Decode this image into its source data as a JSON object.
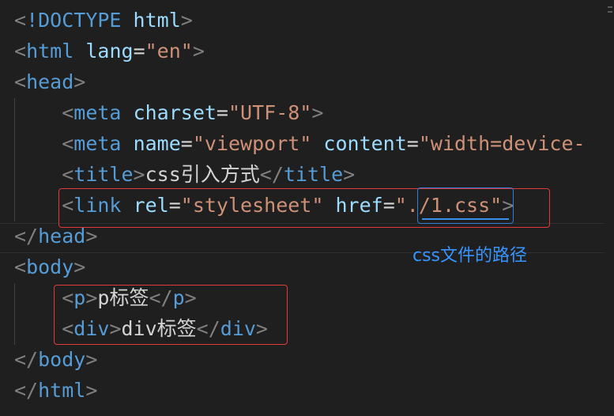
{
  "editor": {
    "lines": [
      [
        {
          "t": "bracket",
          "v": "<"
        },
        {
          "t": "tag",
          "v": "!DOCTYPE"
        },
        {
          "t": "text",
          "v": " "
        },
        {
          "t": "attr",
          "v": "html"
        },
        {
          "t": "bracket",
          "v": ">"
        }
      ],
      [
        {
          "t": "bracket",
          "v": "<"
        },
        {
          "t": "tag",
          "v": "html"
        },
        {
          "t": "text",
          "v": " "
        },
        {
          "t": "attr",
          "v": "lang"
        },
        {
          "t": "text",
          "v": "="
        },
        {
          "t": "str",
          "v": "\"en\""
        },
        {
          "t": "bracket",
          "v": ">"
        }
      ],
      [
        {
          "t": "bracket",
          "v": "<"
        },
        {
          "t": "tag",
          "v": "head"
        },
        {
          "t": "bracket",
          "v": ">"
        }
      ],
      [
        {
          "t": "text",
          "v": "    "
        },
        {
          "t": "bracket",
          "v": "<"
        },
        {
          "t": "tag",
          "v": "meta"
        },
        {
          "t": "text",
          "v": " "
        },
        {
          "t": "attr",
          "v": "charset"
        },
        {
          "t": "text",
          "v": "="
        },
        {
          "t": "str",
          "v": "\"UTF-8\""
        },
        {
          "t": "bracket",
          "v": ">"
        }
      ],
      [
        {
          "t": "text",
          "v": "    "
        },
        {
          "t": "bracket",
          "v": "<"
        },
        {
          "t": "tag",
          "v": "meta"
        },
        {
          "t": "text",
          "v": " "
        },
        {
          "t": "attr",
          "v": "name"
        },
        {
          "t": "text",
          "v": "="
        },
        {
          "t": "str",
          "v": "\"viewport\""
        },
        {
          "t": "text",
          "v": " "
        },
        {
          "t": "attr",
          "v": "content"
        },
        {
          "t": "text",
          "v": "="
        },
        {
          "t": "str",
          "v": "\"width=device-"
        }
      ],
      [
        {
          "t": "text",
          "v": "    "
        },
        {
          "t": "bracket",
          "v": "<"
        },
        {
          "t": "tag",
          "v": "title"
        },
        {
          "t": "bracket",
          "v": ">"
        },
        {
          "t": "text",
          "v": "css引入方式"
        },
        {
          "t": "bracket",
          "v": "</"
        },
        {
          "t": "tag",
          "v": "title"
        },
        {
          "t": "bracket",
          "v": ">"
        }
      ],
      [
        {
          "t": "text",
          "v": "    "
        },
        {
          "t": "bracket",
          "v": "<"
        },
        {
          "t": "tag",
          "v": "link"
        },
        {
          "t": "text",
          "v": " "
        },
        {
          "t": "attr",
          "v": "rel"
        },
        {
          "t": "text",
          "v": "="
        },
        {
          "t": "str",
          "v": "\"stylesheet\""
        },
        {
          "t": "text",
          "v": " "
        },
        {
          "t": "attr",
          "v": "href"
        },
        {
          "t": "text",
          "v": "="
        },
        {
          "t": "str",
          "v": "\"./1.css\""
        },
        {
          "t": "bracket",
          "v": ">"
        }
      ],
      [
        {
          "t": "bracket",
          "v": "</"
        },
        {
          "t": "tag",
          "v": "head"
        },
        {
          "t": "bracket",
          "v": ">"
        }
      ],
      [
        {
          "t": "bracket",
          "v": "<"
        },
        {
          "t": "tag",
          "v": "body"
        },
        {
          "t": "bracket",
          "v": ">"
        }
      ],
      [
        {
          "t": "text",
          "v": "    "
        },
        {
          "t": "bracket",
          "v": "<"
        },
        {
          "t": "tag",
          "v": "p"
        },
        {
          "t": "bracket",
          "v": ">"
        },
        {
          "t": "text",
          "v": "p标签"
        },
        {
          "t": "bracket",
          "v": "</"
        },
        {
          "t": "tag",
          "v": "p"
        },
        {
          "t": "bracket",
          "v": ">"
        }
      ],
      [
        {
          "t": "text",
          "v": "    "
        },
        {
          "t": "bracket",
          "v": "<"
        },
        {
          "t": "tag",
          "v": "div"
        },
        {
          "t": "bracket",
          "v": ">"
        },
        {
          "t": "text",
          "v": "div标签"
        },
        {
          "t": "bracket",
          "v": "</"
        },
        {
          "t": "tag",
          "v": "div"
        },
        {
          "t": "bracket",
          "v": ">"
        }
      ],
      [
        {
          "t": "bracket",
          "v": "</"
        },
        {
          "t": "tag",
          "v": "body"
        },
        {
          "t": "bracket",
          "v": ">"
        }
      ],
      [
        {
          "t": "bracket",
          "v": "</"
        },
        {
          "t": "tag",
          "v": "html"
        },
        {
          "t": "bracket",
          "v": ">"
        }
      ]
    ],
    "annotation": "css文件的路径"
  },
  "colors": {
    "background": "#1f1f1f",
    "tag": "#569cd6",
    "attribute": "#9cdcfe",
    "string": "#ce9178",
    "bracket": "#808080",
    "text": "#d4d4d4",
    "highlight_red": "#e03a3a",
    "highlight_blue": "#2f7fd8",
    "annotation": "#3794ff"
  }
}
